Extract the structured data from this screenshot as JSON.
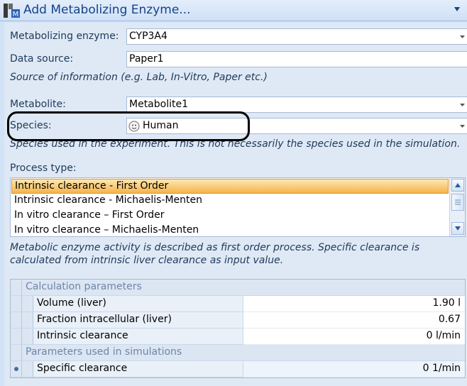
{
  "window": {
    "title": "Add Metabolizing Enzyme..."
  },
  "form": {
    "enzyme": {
      "label": "Metabolizing enzyme:",
      "value": "CYP3A4"
    },
    "data_source": {
      "label": "Data source:",
      "value": "Paper1",
      "hint": "Source of information (e.g. Lab, In-Vitro, Paper etc.)"
    },
    "metabolite": {
      "label": "Metabolite:",
      "value": "Metabolite1"
    },
    "species": {
      "label": "Species:",
      "value": "Human",
      "icon": "species-icon",
      "hint": "Species used in the experiment. This is not necessarily the species used in the simulation."
    }
  },
  "process": {
    "label": "Process type:",
    "items": [
      {
        "label": "Intrinsic clearance - First Order",
        "selected": true
      },
      {
        "label": "Intrinsic clearance - Michaelis-Menten",
        "selected": false
      },
      {
        "label": "In vitro clearance – First Order",
        "selected": false
      },
      {
        "label": "In vitro clearance – Michaelis-Menten",
        "selected": false
      }
    ],
    "description_line1": "Metabolic enzyme activity is described as first order process. Specific clearance is",
    "description_line2": "calculated from intrinsic liver clearance as input value."
  },
  "parameters": {
    "group1": "Calculation parameters",
    "rows": [
      {
        "name": "Volume (liver)",
        "value": "1.90 l"
      },
      {
        "name": "Fraction intracellular (liver)",
        "value": "0.67"
      },
      {
        "name": "Intrinsic clearance",
        "value": "0 l/min"
      }
    ],
    "group2": "Parameters used in simulations",
    "sim_rows": [
      {
        "name": "Specific clearance",
        "value": "0 1/min"
      }
    ]
  },
  "colors": {
    "selection_top": "#fde8b2",
    "selection_bottom": "#f6b34a",
    "panel": "#dfe9f5",
    "highlight_ring": "#000000"
  }
}
